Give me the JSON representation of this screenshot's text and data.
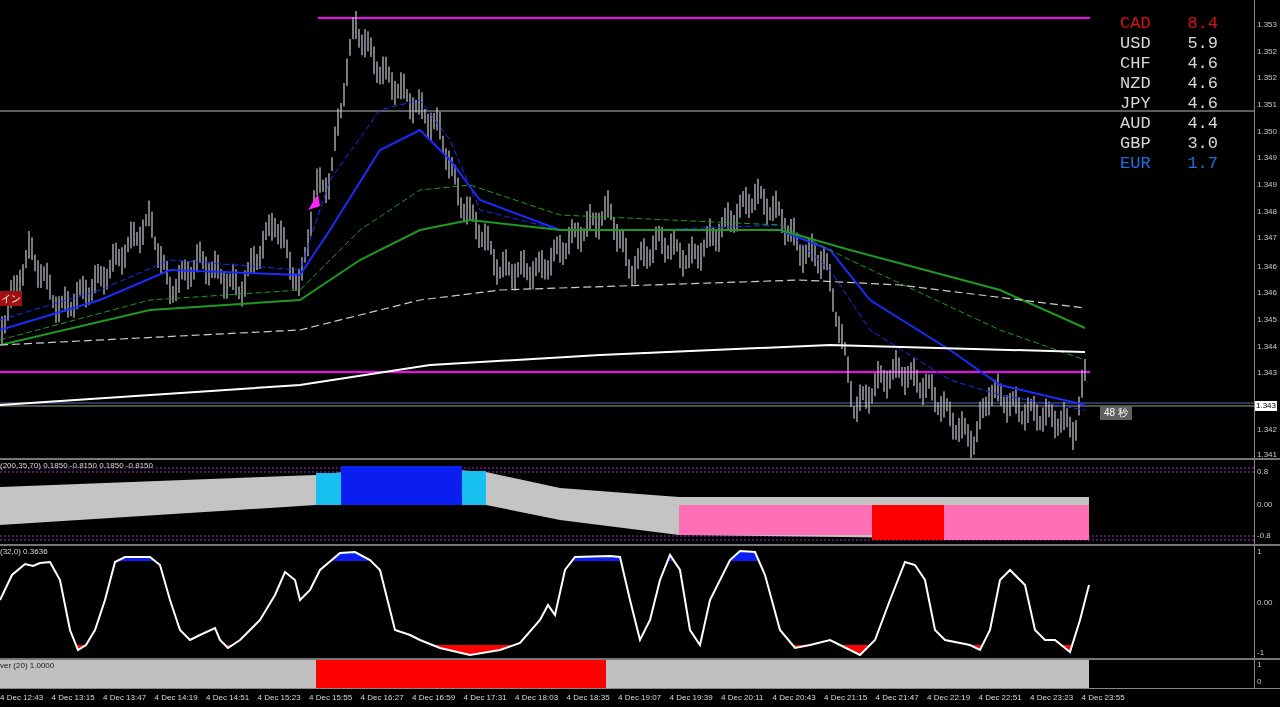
{
  "chart": {
    "price_axis": [
      "1.353",
      "1.352",
      "1.352",
      "1.351",
      "1.350",
      "1.349",
      "1.349",
      "1.348",
      "1.347",
      "1.346",
      "1.346",
      "1.345",
      "1.344",
      "1.343",
      "1.342",
      "1.341"
    ],
    "current_price": "1.343",
    "countdown": "48 秒",
    "marker_label": "イン"
  },
  "currency_strength": [
    {
      "currency": "CAD",
      "value": "8.4",
      "color": "#dd1111"
    },
    {
      "currency": "USD",
      "value": "5.9",
      "color": "#d8d8d8"
    },
    {
      "currency": "CHF",
      "value": "4.6",
      "color": "#d8d8d8"
    },
    {
      "currency": "NZD",
      "value": "4.6",
      "color": "#d8d8d8"
    },
    {
      "currency": "JPY",
      "value": "4.6",
      "color": "#d8d8d8"
    },
    {
      "currency": "AUD",
      "value": "4.4",
      "color": "#d8d8d8"
    },
    {
      "currency": "GBP",
      "value": "3.0",
      "color": "#d8d8d8"
    },
    {
      "currency": "EUR",
      "value": "1.7",
      "color": "#1e6fe0"
    }
  ],
  "indicators": [
    {
      "kind": "band",
      "label": "(200,35,70) 0.1850 -0.8150 0.1850 -0.8150",
      "axis": [
        "0.8",
        "0.00",
        "-0.8"
      ]
    },
    {
      "kind": "oscillator",
      "label": "(32,0) 0.3636",
      "axis": [
        "1",
        "0.00",
        "-1"
      ]
    },
    {
      "kind": "bar",
      "label": "ver (20) 1.0000",
      "axis": [
        "1",
        "0"
      ]
    }
  ],
  "time_axis": [
    "4 Dec 12:43",
    "4 Dec 13:15",
    "4 Dec 13:47",
    "4 Dec 14:19",
    "4 Dec 14:51",
    "4 Dec 15:23",
    "4 Dec 15:55",
    "4 Dec 16:27",
    "4 Dec 16:59",
    "4 Dec 17:31",
    "4 Dec 18:03",
    "4 Dec 18:35",
    "4 Dec 19:07",
    "4 Dec 19:39",
    "4 Dec 20:11",
    "4 Dec 20:43",
    "4 Dec 21:15",
    "4 Dec 21:47",
    "4 Dec 22:19",
    "4 Dec 22:51",
    "4 Dec 23:23",
    "4 Dec 23:55"
  ]
}
